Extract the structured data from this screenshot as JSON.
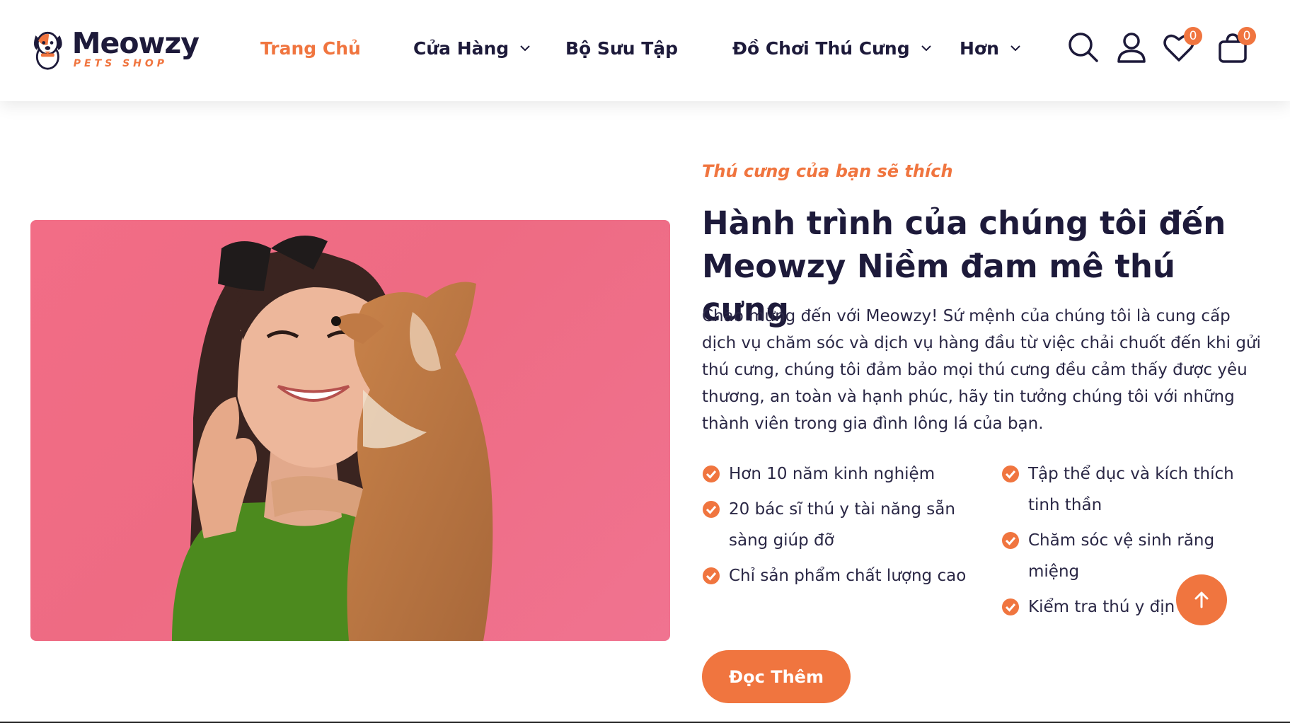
{
  "brand": {
    "name": "Meowzy",
    "sub": "PETS SHOP"
  },
  "nav": {
    "home": "Trang Chủ",
    "shop": "Cửa Hàng",
    "collection": "Bộ Sưu Tập",
    "toys": "Đồ Chơi Thú Cưng",
    "more": "Hơn"
  },
  "header_icons": {
    "search": "search-icon",
    "account": "user-icon",
    "wishlist": "heart-icon",
    "cart": "bag-icon"
  },
  "counts": {
    "wishlist": "0",
    "cart": "0"
  },
  "hero": {
    "tagline": "Thú cưng của bạn sẽ thích",
    "headline_line1": "Hành trình của chúng tôi đến",
    "headline_line2": "Meowzy Niềm đam mê thú cưng",
    "description": "Chào mừng đến với Meowzy! Sứ mệnh của chúng tôi là cung cấp dịch vụ chăm sóc và dịch vụ hàng đầu từ việc chải chuốt đến khi gửi thú cưng, chúng tôi đảm bảo mọi thú cưng đều cảm thấy được yêu thương, an toàn và hạnh phúc, hãy tin tưởng chúng tôi với những thành viên trong gia đình lông lá của bạn.",
    "features_left": [
      "Hơn 10 năm kinh nghiệm",
      "20 bác sĩ thú y tài năng sẵn sàng giúp đỡ",
      "Chỉ sản phẩm chất lượng cao"
    ],
    "features_right": [
      "Tập thể dục và kích thích tinh thần",
      "Chăm sóc vệ sinh răng miệng",
      "Kiểm tra thú y địn"
    ],
    "cta": "Đọc Thêm"
  },
  "colors": {
    "accent": "#f0753f",
    "text": "#1d1a3a",
    "photo_bg": "#f06d86"
  }
}
